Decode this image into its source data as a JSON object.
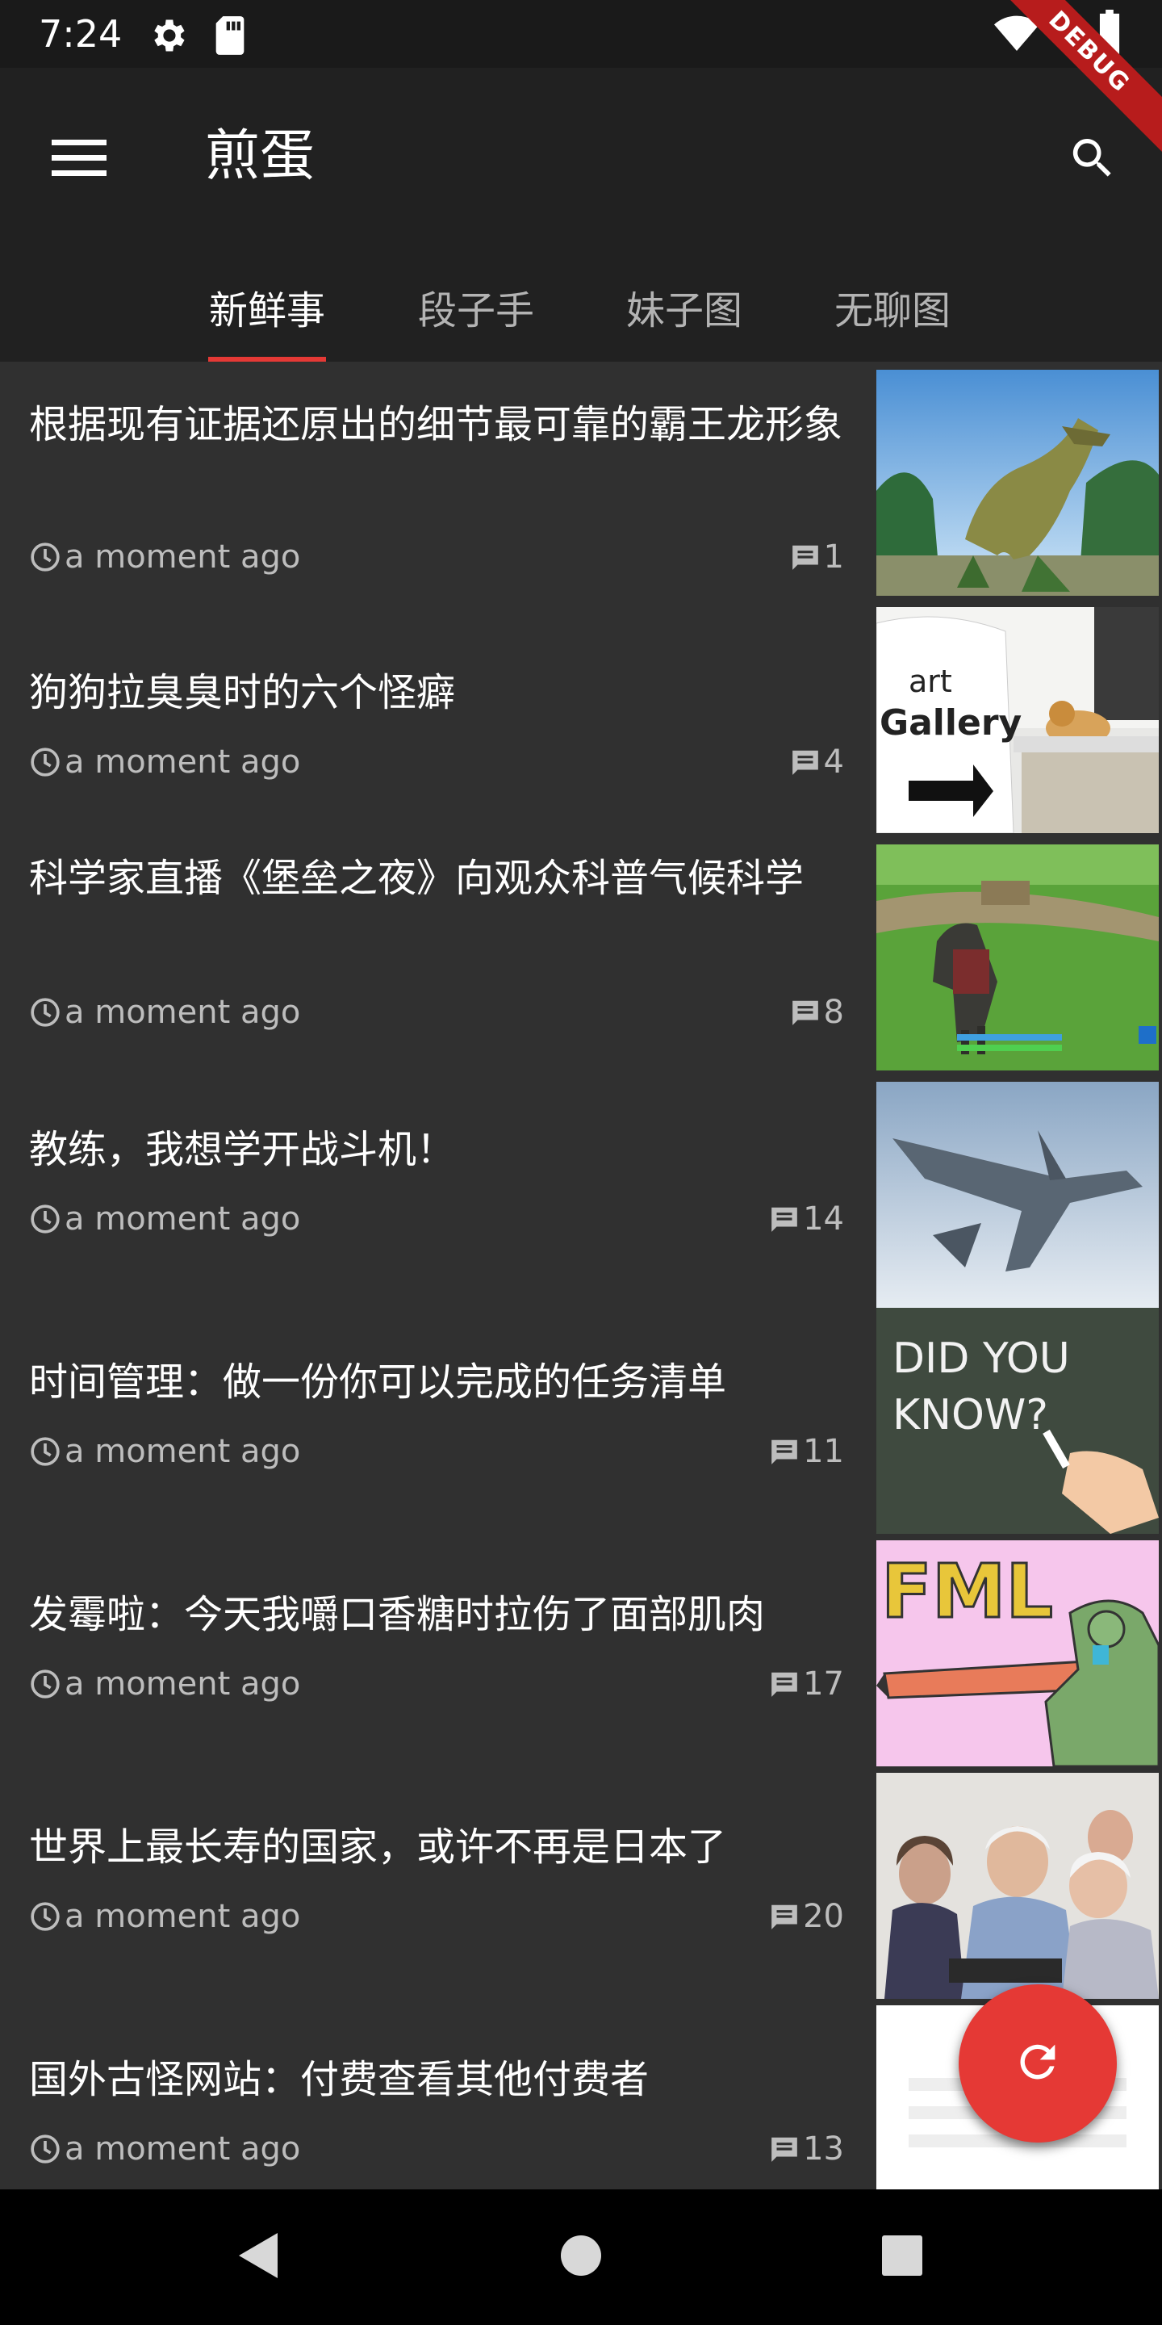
{
  "status_bar": {
    "time": "7:24",
    "icons": [
      "settings-icon",
      "sd-card-icon",
      "wifi-icon",
      "battery-icon"
    ]
  },
  "debug_banner": "DEBUG",
  "app_bar": {
    "title": "煎蛋",
    "menu_icon": "menu-icon",
    "search_icon": "search-icon",
    "tabs": [
      {
        "label": "新鲜事",
        "active": true
      },
      {
        "label": "段子手",
        "active": false
      },
      {
        "label": "妹子图",
        "active": false
      },
      {
        "label": "无聊图",
        "active": false
      }
    ]
  },
  "colors": {
    "accent": "#e53935",
    "background": "#303030",
    "app_bar": "#212121",
    "secondary_text": "#bdbdbd"
  },
  "feed": {
    "items": [
      {
        "title": "根据现有证据还原出的细节最可靠的霸王龙形象",
        "time": "a moment ago",
        "comments": "1"
      },
      {
        "title": "狗狗拉臭臭时的六个怪癖",
        "time": "a moment ago",
        "comments": "4"
      },
      {
        "title": "科学家直播《堡垒之夜》向观众科普气候科学",
        "time": "a moment ago",
        "comments": "8"
      },
      {
        "title": "教练，我想学开战斗机！",
        "time": "a moment ago",
        "comments": "14"
      },
      {
        "title": "时间管理：做一份你可以完成的任务清单",
        "time": "a moment ago",
        "comments": "11"
      },
      {
        "title": "发霉啦：今天我嚼口香糖时拉伤了面部肌肉",
        "time": "a moment ago",
        "comments": "17"
      },
      {
        "title": "世界上最长寿的国家，或许不再是日本了",
        "time": "a moment ago",
        "comments": "20"
      },
      {
        "title": "国外古怪网站：付费查看其他付费者",
        "time": "a moment ago",
        "comments": "13"
      }
    ],
    "thumb_texts": {
      "gallery": [
        "art",
        "Gallery"
      ],
      "did_you_know": [
        "DID YOU",
        "KNOW?"
      ],
      "fml": "FML"
    }
  },
  "fab": {
    "icon": "refresh-icon"
  },
  "nav_bar": {
    "icons": [
      "back-icon",
      "home-icon",
      "recents-icon"
    ]
  }
}
